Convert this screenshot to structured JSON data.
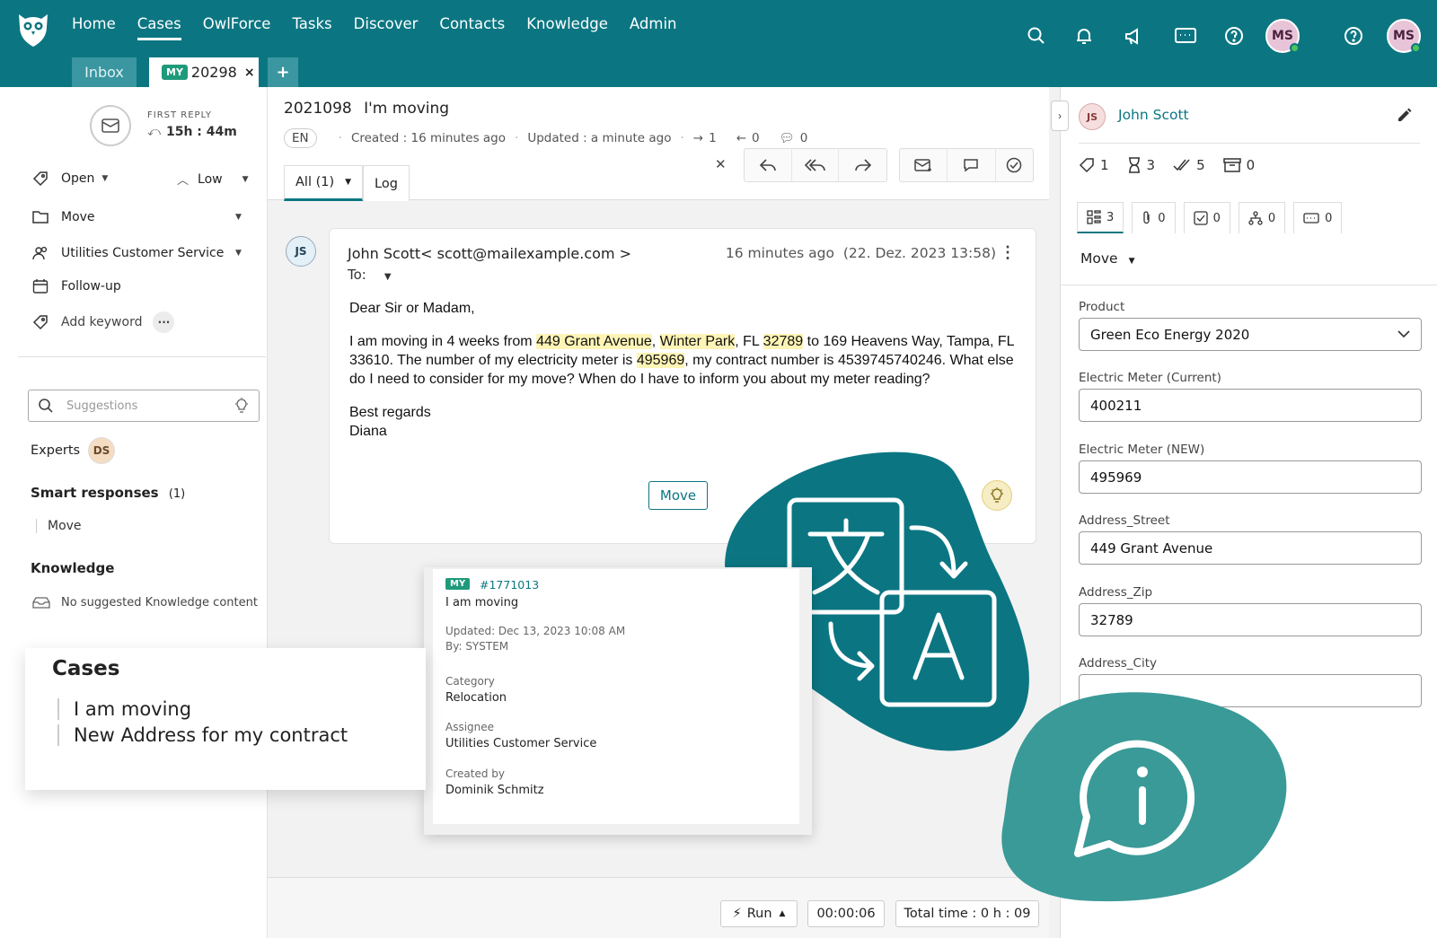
{
  "nav": {
    "items": [
      "Home",
      "Cases",
      "OwlForce",
      "Tasks",
      "Discover",
      "Contacts",
      "Knowledge",
      "Admin"
    ],
    "active": "Cases",
    "user_initials_1": "MS",
    "user_initials_2": "MS"
  },
  "tabs": {
    "inbox": "Inbox",
    "case_badge": "MY",
    "case_number": "20298",
    "close": "×",
    "add": "+"
  },
  "left": {
    "first_reply_label": "FIRST REPLY",
    "first_reply_value": "15h : 44m",
    "status": "Open",
    "priority": "Low",
    "category": "Move",
    "group": "Utilities Customer Service",
    "followup": "Follow-up",
    "add_keyword": "Add keyword",
    "more": "···",
    "suggestions_placeholder": "Suggestions",
    "experts_label": "Experts",
    "expert_initials": "DS",
    "smart_responses_label": "Smart responses",
    "smart_responses_count": "(1)",
    "smart_response_item": "Move",
    "knowledge_label": "Knowledge",
    "knowledge_empty": "No suggested Knowledge content"
  },
  "case": {
    "id": "2021098",
    "title": "I'm moving",
    "lang": "EN",
    "created": "Created : 16 minutes ago",
    "updated": "Updated : a minute ago",
    "outgoing": "1",
    "incoming": "0",
    "comments": "0",
    "view_tab_all": "All (1)",
    "view_tab_log": "Log"
  },
  "email": {
    "sender_initials": "JS",
    "from": "John Scott< scott@mailexample.com >",
    "to": "To:",
    "time": "16 minutes ago  (22. Dez. 2023 13:58)",
    "greeting": "Dear Sir or Madam,",
    "p1_a": "I am moving in 4 weeks from ",
    "p1_street": "449 Grant Avenue",
    "p1_b": ", ",
    "p1_city": "Winter Park",
    "p1_c": ", FL ",
    "p1_zip": "32789",
    "p1_d": " to 169 Heavens Way, Tampa, FL 33610. The number of my electricity meter is ",
    "p1_meter": "495969",
    "p1_e": ", my contract number is 4539745740246. What else do I need to consider for my move? When do I have to inform you about my meter reading?",
    "closing": "Best regards",
    "signature": "Diana",
    "move_button": "Move"
  },
  "footer": {
    "run": "Run",
    "timer": "00:00:06",
    "total": "Total time : 0 h : 09"
  },
  "right": {
    "customer_initials": "JS",
    "customer_name": "John Scott",
    "stats": [
      "1",
      "3",
      "5",
      "0"
    ],
    "tabs": [
      "3",
      "0",
      "0",
      "0",
      "0"
    ],
    "category": "Move",
    "fields": [
      {
        "label": "Product",
        "value": "Green Eco Energy 2020"
      },
      {
        "label": "Electric Meter (Current)",
        "value": "400211"
      },
      {
        "label": "Electric Meter (NEW)",
        "value": "495969"
      },
      {
        "label": "Address_Street",
        "value": "449 Grant Avenue"
      },
      {
        "label": "Address_Zip",
        "value": "32789"
      },
      {
        "label": "Address_City",
        "value": ""
      }
    ]
  },
  "cases_card": {
    "title": "Cases",
    "items": [
      "I am moving",
      "New Address for my contract"
    ]
  },
  "popup": {
    "badge": "MY",
    "number": "#1771013",
    "title": "I am moving",
    "updated": "Updated: Dec 13, 2023 10:08 AM",
    "by": "By: SYSTEM",
    "category_label": "Category",
    "category_value": "Relocation",
    "assignee_label": "Assignee",
    "assignee_value": "Utilities Customer Service",
    "created_label": "Created by",
    "created_value": "Dominik Schmitz"
  },
  "colors": {
    "brand": "#0b7682",
    "blob_dark": "#0b7682",
    "blob_light": "#3a9a98",
    "highlight": "#fdf4b6"
  }
}
